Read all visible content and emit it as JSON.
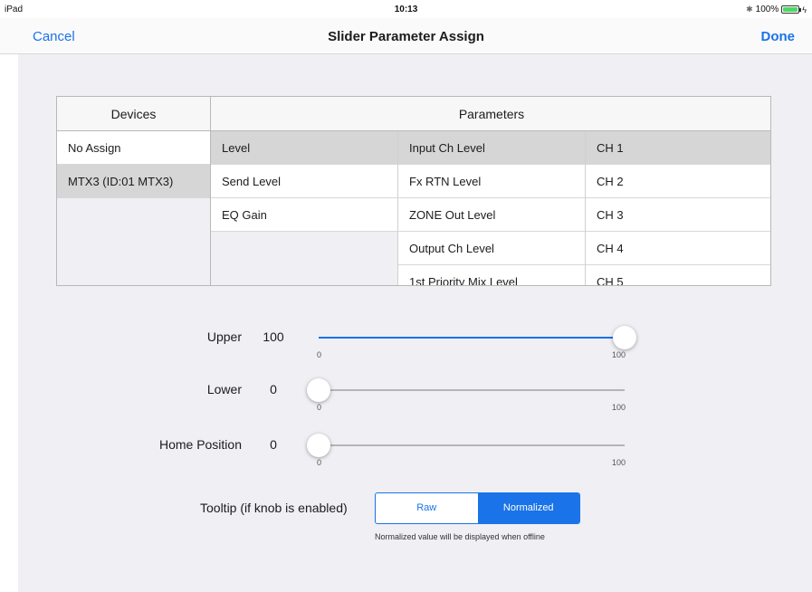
{
  "status_bar": {
    "device": "iPad",
    "time": "10:13",
    "battery": "100%"
  },
  "nav": {
    "cancel_label": "Cancel",
    "title": "Slider Parameter Assign",
    "done_label": "Done"
  },
  "table": {
    "devices_header": "Devices",
    "parameters_header": "Parameters",
    "devices": [
      "No Assign",
      "MTX3 (ID:01 MTX3)"
    ],
    "param_col1": [
      "Level",
      "Send Level",
      "EQ Gain"
    ],
    "param_col2": [
      "Input Ch Level",
      "Fx RTN Level",
      "ZONE Out Level",
      "Output Ch Level",
      "1st Priority Mix Level"
    ],
    "param_col3": [
      "CH 1",
      "CH 2",
      "CH 3",
      "CH 4",
      "CH 5"
    ],
    "selected": {
      "device": 1,
      "param_col1": 0,
      "param_col2": 0,
      "param_col3": 0
    }
  },
  "sliders": {
    "upper": {
      "label": "Upper",
      "value": "100",
      "min": "0",
      "max": "100",
      "level": 100
    },
    "lower": {
      "label": "Lower",
      "value": "0",
      "min": "0",
      "max": "100",
      "level": 0
    },
    "home": {
      "label": "Home Position",
      "value": "0",
      "min": "0",
      "max": "100",
      "level": 0
    }
  },
  "tooltip": {
    "label": "Tooltip (if knob is enabled)",
    "options": [
      "Raw",
      "Normalized"
    ],
    "selected": "Normalized",
    "note": "Normalized value will be displayed when offline"
  },
  "colors": {
    "accent": "#1a73e8",
    "battery": "#4cd964",
    "selected_row": "#d6d6d6",
    "background": "#efeff4"
  },
  "icons": {
    "bluetooth": "bluetooth-icon",
    "battery": "battery-icon",
    "charging": "charging-bolt-icon"
  }
}
